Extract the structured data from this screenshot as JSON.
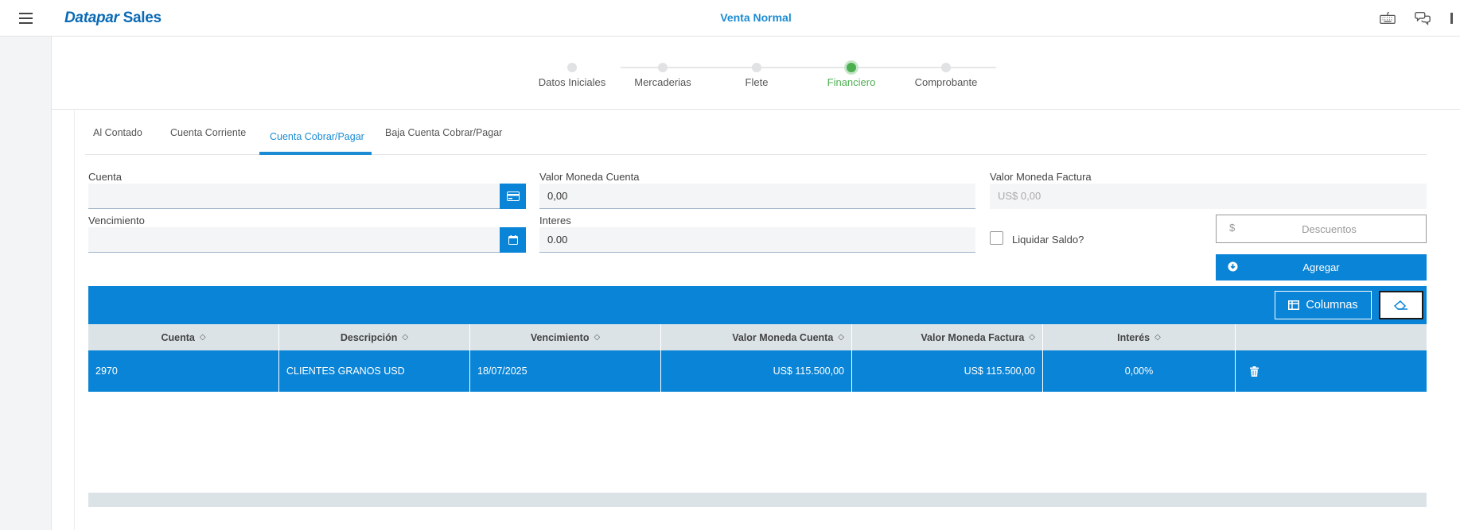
{
  "app": {
    "brand_part1": "Datapar",
    "brand_part2": "Sales",
    "title": "Venta Normal"
  },
  "top_icons": [
    "keyboard-icon",
    "chat-icon"
  ],
  "stepper": {
    "steps": [
      {
        "label": "Datos Iniciales"
      },
      {
        "label": "Mercaderias"
      },
      {
        "label": "Flete"
      },
      {
        "label": "Financiero",
        "active": true
      },
      {
        "label": "Comprobante"
      }
    ]
  },
  "tabs": [
    {
      "label": "Al Contado"
    },
    {
      "label": "Cuenta Corriente"
    },
    {
      "label": "Cuenta Cobrar/Pagar",
      "active": true
    },
    {
      "label": "Baja Cuenta Cobrar/Pagar"
    }
  ],
  "form": {
    "cuenta": {
      "label": "Cuenta",
      "value": ""
    },
    "valor_moneda_cuenta": {
      "label": "Valor Moneda Cuenta",
      "value": "0,00"
    },
    "valor_moneda_factura": {
      "label": "Valor Moneda Factura",
      "value": "US$ 0,00"
    },
    "vencimiento": {
      "label": "Vencimiento",
      "value": ""
    },
    "interes": {
      "label": "Interes",
      "value": "0.00"
    },
    "liquidar_saldo": {
      "label": "Liquidar Saldo?",
      "checked": false
    },
    "descuentos": {
      "prefix": "$",
      "placeholder": "Descuentos"
    },
    "agregar_label": "Agregar"
  },
  "grid": {
    "columnas_label": "Columnas",
    "columns": [
      "Cuenta",
      "Descripción",
      "Vencimiento",
      "Valor Moneda Cuenta",
      "Valor Moneda Factura",
      "Interés"
    ],
    "rows": [
      {
        "cuenta": "2970",
        "descripcion": "CLIENTES GRANOS USD",
        "vencimiento": "18/07/2025",
        "valor_cuenta": "US$ 115.500,00",
        "valor_factura": "US$ 115.500,00",
        "interes": "0,00%"
      }
    ]
  },
  "colors": {
    "primary": "#0a84d6",
    "brand": "#0a6ab5",
    "active_step": "#4caf50"
  }
}
